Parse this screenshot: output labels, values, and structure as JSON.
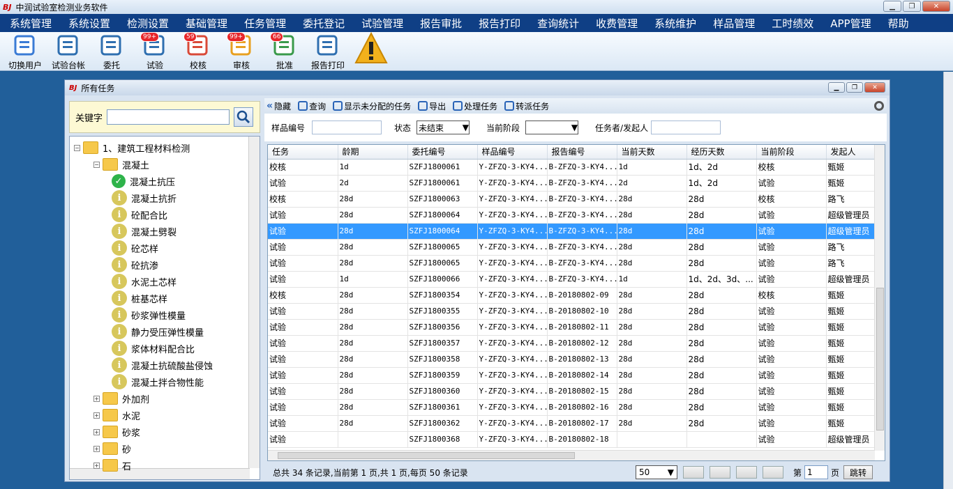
{
  "app": {
    "logo": "BJ",
    "title": "中润试验室检测业务软件"
  },
  "menu": [
    "系统管理",
    "系统设置",
    "检测设置",
    "基础管理",
    "任务管理",
    "委托登记",
    "试验管理",
    "报告审批",
    "报告打印",
    "查询统计",
    "收费管理",
    "系统维护",
    "样品管理",
    "工时绩效",
    "APP管理",
    "帮助"
  ],
  "toolbar": [
    {
      "label": "切换用户",
      "icon": "switch-user-icon",
      "badge": ""
    },
    {
      "label": "试验台帐",
      "icon": "ledger-icon",
      "badge": ""
    },
    {
      "label": "委托",
      "icon": "commission-icon",
      "badge": ""
    },
    {
      "label": "试验",
      "icon": "test-icon",
      "badge": "99+"
    },
    {
      "label": "校核",
      "icon": "check-icon",
      "badge": "59"
    },
    {
      "label": "审核",
      "icon": "review-icon",
      "badge": "99+"
    },
    {
      "label": "批准",
      "icon": "approve-icon",
      "badge": "66"
    },
    {
      "label": "报告打印",
      "icon": "printer-icon",
      "badge": ""
    },
    {
      "label": "",
      "icon": "warning-icon",
      "badge": ""
    }
  ],
  "child": {
    "title": "所有任务",
    "logo": "BJ"
  },
  "search": {
    "label": "关键字",
    "value": ""
  },
  "tree": [
    {
      "label": "1、建筑工程材料检测",
      "level": 0,
      "kind": "folder",
      "exp": "−"
    },
    {
      "label": "混凝土",
      "level": 1,
      "kind": "folder",
      "exp": "−"
    },
    {
      "label": "混凝土抗压",
      "level": 2,
      "kind": "ok"
    },
    {
      "label": "混凝土抗折",
      "level": 2,
      "kind": "info"
    },
    {
      "label": "砼配合比",
      "level": 2,
      "kind": "info"
    },
    {
      "label": "混凝土劈裂",
      "level": 2,
      "kind": "info"
    },
    {
      "label": "砼芯样",
      "level": 2,
      "kind": "info"
    },
    {
      "label": "砼抗渗",
      "level": 2,
      "kind": "info"
    },
    {
      "label": "水泥土芯样",
      "level": 2,
      "kind": "info"
    },
    {
      "label": "桩基芯样",
      "level": 2,
      "kind": "info"
    },
    {
      "label": "砂浆弹性模量",
      "level": 2,
      "kind": "info"
    },
    {
      "label": "静力受压弹性模量",
      "level": 2,
      "kind": "info"
    },
    {
      "label": "浆体材料配合比",
      "level": 2,
      "kind": "info"
    },
    {
      "label": "混凝土抗硫酸盐侵蚀",
      "level": 2,
      "kind": "info"
    },
    {
      "label": "混凝土拌合物性能",
      "level": 2,
      "kind": "info"
    },
    {
      "label": "外加剂",
      "level": 1,
      "kind": "folder",
      "exp": "+"
    },
    {
      "label": "水泥",
      "level": 1,
      "kind": "folder",
      "exp": "+"
    },
    {
      "label": "砂浆",
      "level": 1,
      "kind": "folder",
      "exp": "+"
    },
    {
      "label": "砂",
      "level": 1,
      "kind": "folder",
      "exp": "+"
    },
    {
      "label": "石",
      "level": 1,
      "kind": "folder",
      "exp": "+"
    }
  ],
  "rtoolbar": [
    "隐藏",
    "查询",
    "显示未分配的任务",
    "导出",
    "处理任务",
    "转派任务"
  ],
  "filter": {
    "sample_label": "样品编号",
    "status_label": "状态",
    "status_value": "未结束",
    "stage_label": "当前阶段",
    "stage_value": "",
    "assignee_label": "任务者/发起人"
  },
  "columns": [
    "任务",
    "龄期",
    "委托编号",
    "样品编号",
    "报告编号",
    "当前天数",
    "经历天数",
    "当前阶段",
    "发起人"
  ],
  "rows": [
    [
      "校核",
      "1d",
      "SZFJ1800061",
      "Y-ZFZQ-3-KY4...",
      "B-ZFZQ-3-KY4...",
      "1d",
      "1d、2d",
      "校核",
      "甄姬"
    ],
    [
      "试验",
      "2d",
      "SZFJ1800061",
      "Y-ZFZQ-3-KY4...",
      "B-ZFZQ-3-KY4...",
      "2d",
      "1d、2d",
      "试验",
      "甄姬"
    ],
    [
      "校核",
      "28d",
      "SZFJ1800063",
      "Y-ZFZQ-3-KY4...",
      "B-ZFZQ-3-KY4...",
      "28d",
      "28d",
      "校核",
      "路飞"
    ],
    [
      "试验",
      "28d",
      "SZFJ1800064",
      "Y-ZFZQ-3-KY4...",
      "B-ZFZQ-3-KY4...",
      "28d",
      "28d",
      "试验",
      "超级管理员"
    ],
    [
      "试验",
      "28d",
      "SZFJ1800064",
      "Y-ZFZQ-3-KY4...",
      "B-ZFZQ-3-KY4...",
      "28d",
      "28d",
      "试验",
      "超级管理员"
    ],
    [
      "试验",
      "28d",
      "SZFJ1800065",
      "Y-ZFZQ-3-KY4...",
      "B-ZFZQ-3-KY4...",
      "28d",
      "28d",
      "试验",
      "路飞"
    ],
    [
      "试验",
      "28d",
      "SZFJ1800065",
      "Y-ZFZQ-3-KY4...",
      "B-ZFZQ-3-KY4...",
      "28d",
      "28d",
      "试验",
      "路飞"
    ],
    [
      "试验",
      "1d",
      "SZFJ1800066",
      "Y-ZFZQ-3-KY4...",
      "B-ZFZQ-3-KY4...",
      "1d",
      "1d、2d、3d、...",
      "试验",
      "超级管理员"
    ],
    [
      "校核",
      "28d",
      "SZFJ1800354",
      "Y-ZFZQ-3-KY4...",
      "B-20180802-09",
      "28d",
      "28d",
      "校核",
      "甄姬"
    ],
    [
      "试验",
      "28d",
      "SZFJ1800355",
      "Y-ZFZQ-3-KY4...",
      "B-20180802-10",
      "28d",
      "28d",
      "试验",
      "甄姬"
    ],
    [
      "试验",
      "28d",
      "SZFJ1800356",
      "Y-ZFZQ-3-KY4...",
      "B-20180802-11",
      "28d",
      "28d",
      "试验",
      "甄姬"
    ],
    [
      "试验",
      "28d",
      "SZFJ1800357",
      "Y-ZFZQ-3-KY4...",
      "B-20180802-12",
      "28d",
      "28d",
      "试验",
      "甄姬"
    ],
    [
      "试验",
      "28d",
      "SZFJ1800358",
      "Y-ZFZQ-3-KY4...",
      "B-20180802-13",
      "28d",
      "28d",
      "试验",
      "甄姬"
    ],
    [
      "试验",
      "28d",
      "SZFJ1800359",
      "Y-ZFZQ-3-KY4...",
      "B-20180802-14",
      "28d",
      "28d",
      "试验",
      "甄姬"
    ],
    [
      "试验",
      "28d",
      "SZFJ1800360",
      "Y-ZFZQ-3-KY4...",
      "B-20180802-15",
      "28d",
      "28d",
      "试验",
      "甄姬"
    ],
    [
      "试验",
      "28d",
      "SZFJ1800361",
      "Y-ZFZQ-3-KY4...",
      "B-20180802-16",
      "28d",
      "28d",
      "试验",
      "甄姬"
    ],
    [
      "试验",
      "28d",
      "SZFJ1800362",
      "Y-ZFZQ-3-KY4...",
      "B-20180802-17",
      "28d",
      "28d",
      "试验",
      "甄姬"
    ],
    [
      "试验",
      "",
      "SZFJ1800368",
      "Y-ZFZQ-3-KY4...",
      "B-20180802-18",
      "",
      "",
      "试验",
      "超级管理员"
    ]
  ],
  "selected_row": 4,
  "pager": {
    "summary": "总共 34 条记录,当前第 1 页,共 1 页,每页 50 条记录",
    "page_size": "50",
    "page_label": "第",
    "page_value": "1",
    "page_suffix": "页",
    "go_label": "跳转"
  },
  "colors": {
    "menu_bg": "#0f3f85",
    "selected_row": "#3399ff",
    "badge": "#e8262a"
  }
}
